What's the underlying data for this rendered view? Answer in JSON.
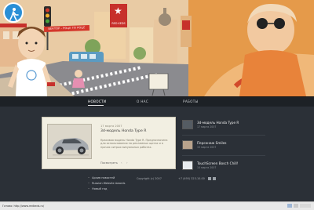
{
  "hero": {
    "tagline": "ВЕКТОР - РОЦЕ ТО РОЦЕ",
    "flag_text": "RED KEDS",
    "icons": {
      "pedestrian": "pedestrian-crossing-icon",
      "flag_star": "star-icon"
    },
    "colors": {
      "sky": "#e7c9a3",
      "accent": "#d4362b"
    }
  },
  "nav": {
    "items": [
      "НОВОСТИ",
      "О НАС",
      "РАБОТЫ"
    ],
    "active": "НОВОСТИ"
  },
  "featured": {
    "date": "17 марта 2007",
    "title": "3d-модель Honda Type R",
    "body": "Красивая модель Honda Type R. Предназначена для использования на рекламных щитах и в прочих хитрых визуальных работах.",
    "more": "Посмотреть"
  },
  "sidebar": [
    {
      "title": "3d-модель Honda Type R",
      "date": "17 марта 2007"
    },
    {
      "title": "Персонаж Smiles",
      "date": "15 марта 2007"
    },
    {
      "title": "TouchScreen Bosch Chill!",
      "date": "14 марта 2007"
    }
  ],
  "bottom_links": [
    "Архив новостей",
    "Russian Website Awards",
    "Новый год"
  ],
  "footer": {
    "copyright": "Copyright (c) 2007",
    "phone": "+7 (495) 323-10-00"
  },
  "status": {
    "text": "Готово: http://www.redkeds.ru/"
  }
}
